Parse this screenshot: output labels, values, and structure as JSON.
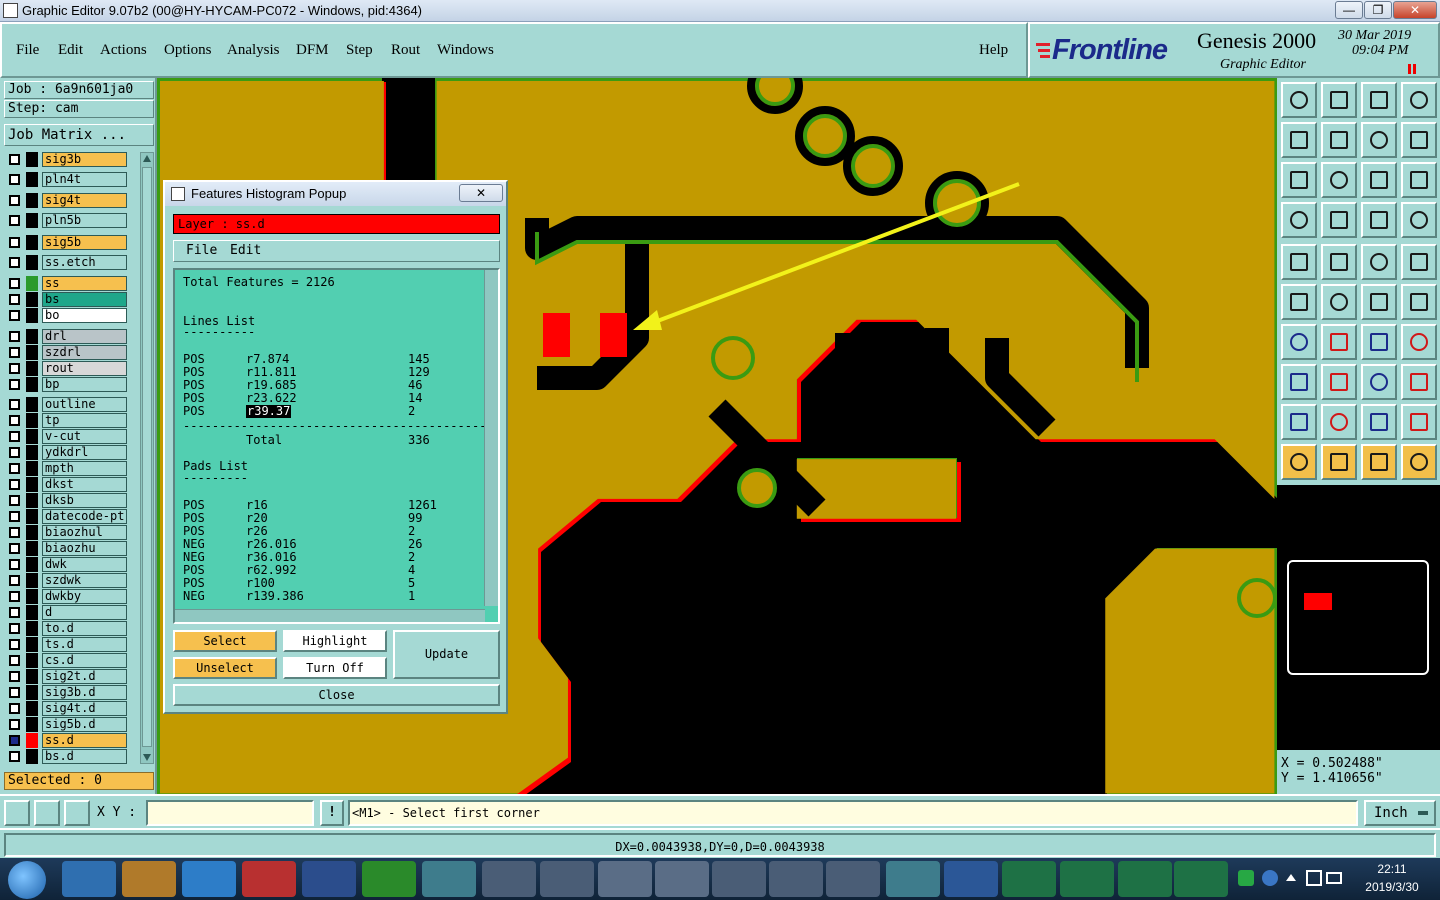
{
  "window": {
    "title": "Graphic Editor 9.07b2 (00@HY-HYCAM-PC072 - Windows, pid:4364)",
    "min_glyph": "—",
    "max_glyph": "❐",
    "close_glyph": "✕"
  },
  "menu": {
    "file": "File",
    "edit": "Edit",
    "actions": "Actions",
    "options": "Options",
    "analysis": "Analysis",
    "dfm": "DFM",
    "step": "Step",
    "rout": "Rout",
    "windows": "Windows",
    "help": "Help"
  },
  "brand": {
    "logo": "Frontline",
    "product": "Genesis 2000",
    "subtitle": "Graphic Editor",
    "date": "30 Mar 2019",
    "time": "09:04 PM"
  },
  "left": {
    "job": "Job : 6a9n601ja0",
    "step": "Step: cam",
    "job_matrix": "Job Matrix ...",
    "selected": "Selected : 0",
    "layers": [
      {
        "name": "sig3b",
        "color": "#f6c04e"
      },
      {
        "name": "pln4t",
        "color": "#a5d9d4"
      },
      {
        "name": "sig4t",
        "color": "#f6c04e"
      },
      {
        "name": "pln5b",
        "color": "#a5d9d4"
      },
      {
        "name": "sig5b",
        "color": "#f6c04e"
      },
      {
        "name": "ss.etch",
        "color": "#a5d9d4"
      },
      {
        "name": "ss",
        "color": "#f6c04e",
        "swatch": "#2b9a2b"
      },
      {
        "name": "bs",
        "color": "#1fa78a"
      },
      {
        "name": "bo",
        "color": "#ffffff"
      },
      {
        "name": "drl",
        "color": "#b9c4c8"
      },
      {
        "name": "szdrl",
        "color": "#b9c4c8"
      },
      {
        "name": "rout",
        "color": "#d8d8d8"
      },
      {
        "name": "bp",
        "color": "#a5d9d4"
      },
      {
        "name": "outline",
        "color": "#a5d9d4"
      },
      {
        "name": "tp",
        "color": "#a5d9d4"
      },
      {
        "name": "v-cut",
        "color": "#a5d9d4"
      },
      {
        "name": "ydkdrl",
        "color": "#a5d9d4"
      },
      {
        "name": "mpth",
        "color": "#a5d9d4"
      },
      {
        "name": "dkst",
        "color": "#a5d9d4"
      },
      {
        "name": "dksb",
        "color": "#a5d9d4"
      },
      {
        "name": "datecode-pt",
        "color": "#a5d9d4"
      },
      {
        "name": "biaozhul",
        "color": "#a5d9d4"
      },
      {
        "name": "biaozhu",
        "color": "#a5d9d4"
      },
      {
        "name": "dwk",
        "color": "#a5d9d4"
      },
      {
        "name": "szdwk",
        "color": "#a5d9d4"
      },
      {
        "name": "dwkby",
        "color": "#a5d9d4"
      },
      {
        "name": "d",
        "color": "#a5d9d4"
      },
      {
        "name": "to.d",
        "color": "#a5d9d4"
      },
      {
        "name": "ts.d",
        "color": "#a5d9d4"
      },
      {
        "name": "cs.d",
        "color": "#a5d9d4"
      },
      {
        "name": "sig2t.d",
        "color": "#a5d9d4"
      },
      {
        "name": "sig3b.d",
        "color": "#a5d9d4"
      },
      {
        "name": "sig4t.d",
        "color": "#a5d9d4"
      },
      {
        "name": "sig5b.d",
        "color": "#a5d9d4"
      },
      {
        "name": "ss.d",
        "color": "#f6c04e",
        "swatch": "#ff0000"
      },
      {
        "name": "bs.d",
        "color": "#a5d9d4"
      }
    ]
  },
  "popup": {
    "title": "Features Histogram Popup",
    "layer": "Layer :  ss.d",
    "menu_file": "File",
    "menu_edit": "Edit",
    "total_features": "Total Features = 2126",
    "lines_header": "Lines List",
    "lines": [
      {
        "pol": "POS",
        "sym": "r7.874",
        "count": "145"
      },
      {
        "pol": "POS",
        "sym": "r11.811",
        "count": "129"
      },
      {
        "pol": "POS",
        "sym": "r19.685",
        "count": "46"
      },
      {
        "pol": "POS",
        "sym": "r23.622",
        "count": "14"
      },
      {
        "pol": "POS",
        "sym": "r39.37",
        "count": "2"
      }
    ],
    "total_label": "Total",
    "lines_total": "336",
    "pads_header": "Pads List",
    "pads": [
      {
        "pol": "POS",
        "sym": "r16",
        "count": "1261"
      },
      {
        "pol": "POS",
        "sym": "r20",
        "count": "99"
      },
      {
        "pol": "POS",
        "sym": "r26",
        "count": "2"
      },
      {
        "pol": "NEG",
        "sym": "r26.016",
        "count": "26"
      },
      {
        "pol": "NEG",
        "sym": "r36.016",
        "count": "2"
      },
      {
        "pol": "POS",
        "sym": "r62.992",
        "count": "4"
      },
      {
        "pol": "POS",
        "sym": "r100",
        "count": "5"
      },
      {
        "pol": "NEG",
        "sym": "r139.386",
        "count": "1"
      }
    ],
    "btn_select": "Select",
    "btn_highlight": "Highlight",
    "btn_unselect": "Unselect",
    "btn_turnoff": "Turn Off",
    "btn_update": "Update",
    "btn_close": "Close"
  },
  "coords": {
    "x": "X = 0.502488\"",
    "y": "Y = 1.410656\""
  },
  "command": {
    "xy_label": "X Y :",
    "xy_value": "",
    "prompt": "<M1> - Select first corner",
    "units": "Inch"
  },
  "status": {
    "measure": "DX=0.0043938,DY=0,D=0.0043938"
  },
  "taskbar": {
    "time": "22:11",
    "date": "2019/3/30"
  },
  "colors": {
    "panel": "#a5d9d4",
    "copper": "#c29a00",
    "outline_green": "#3a9b12",
    "selection_red": "#ff0000",
    "arrow_yellow": "#f2f21a"
  }
}
